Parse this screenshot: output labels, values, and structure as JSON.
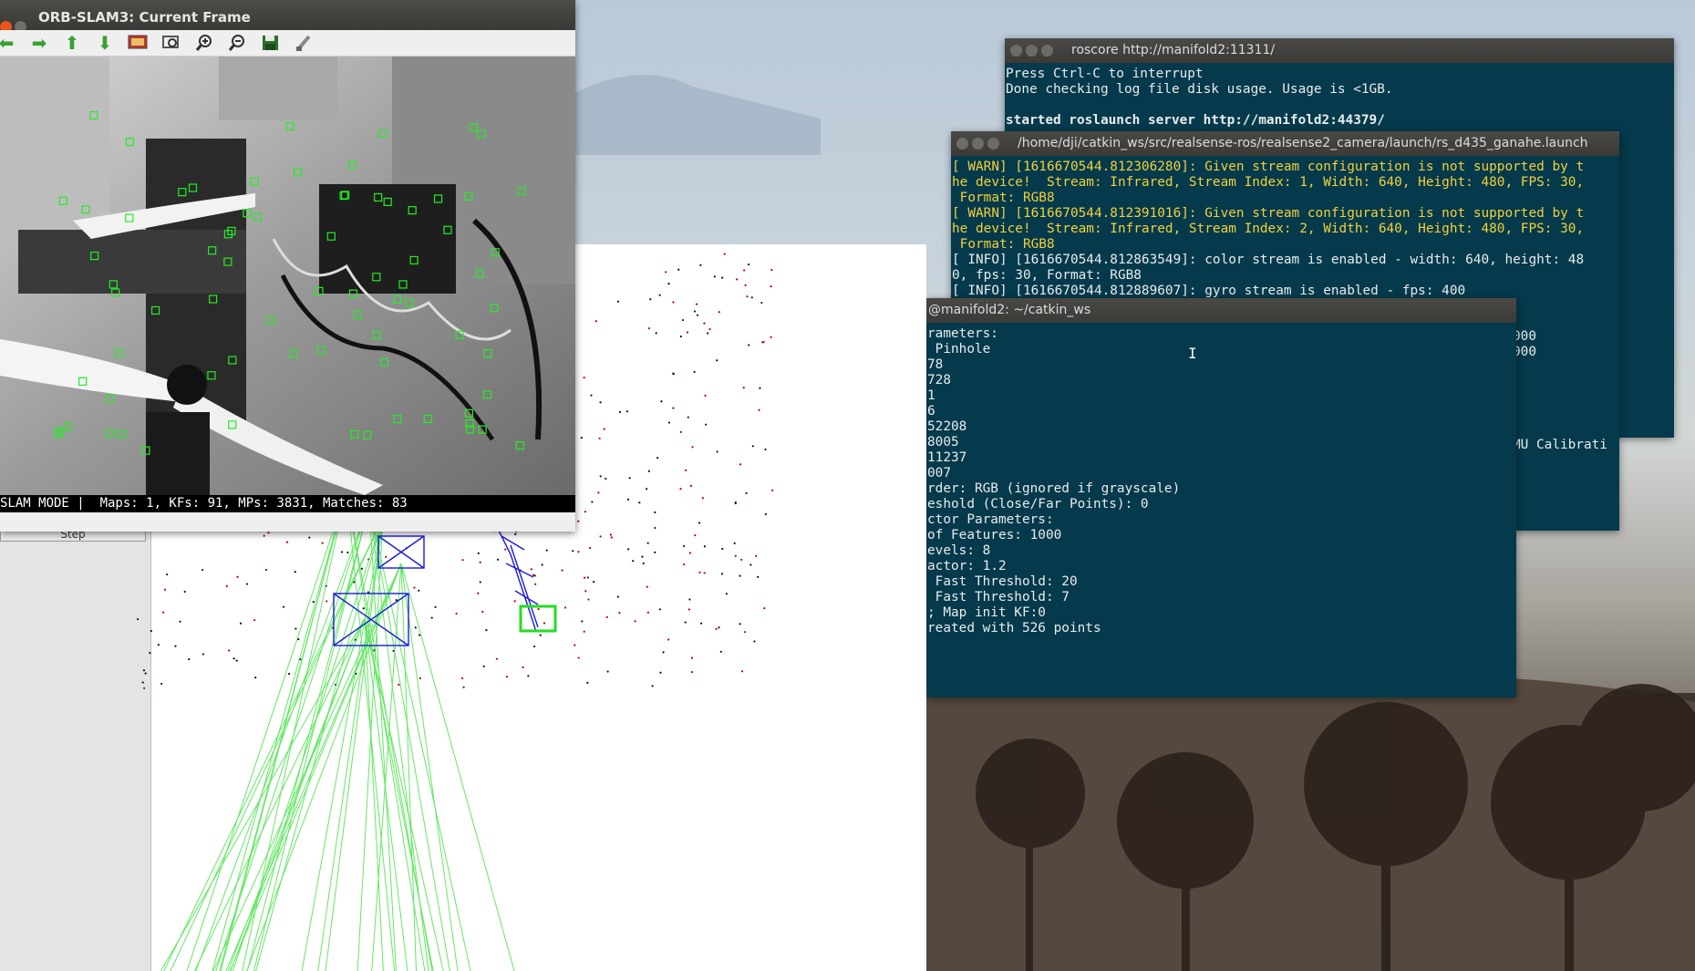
{
  "frame_window": {
    "title": "ORB-SLAM3: Current Frame",
    "status": "SLAM MODE |  Maps: 1, KFs: 91, MPs: 3831, Matches: 83",
    "toolbar": [
      "back-arrow-icon",
      "forward-arrow-icon",
      "up-arrow-icon",
      "down-arrow-icon",
      "image-icon",
      "zoom-fit-icon",
      "zoom-in-icon",
      "zoom-out-icon",
      "save-icon",
      "brush-icon"
    ]
  },
  "map_viewer": {
    "step_label": "Step"
  },
  "roscore_terminal": {
    "title": "roscore http://manifold2:11311/",
    "lines": [
      "Press Ctrl-C to interrupt",
      "Done checking log file disk usage. Usage is <1GB.",
      "",
      "started roslaunch server http://manifold2:44379/"
    ]
  },
  "realsense_terminal": {
    "title": "/home/dji/catkin_ws/src/realsense-ros/realsense2_camera/launch/rs_d435_ganahe.launch",
    "lines": [
      "[ WARN] [1616670544.812306280]: Given stream configuration is not supported by t",
      "he device!  Stream: Infrared, Stream Index: 1, Width: 640, Height: 480, FPS: 30,",
      " Format: RGB8",
      "[ WARN] [1616670544.812391016]: Given stream configuration is not supported by t",
      "he device!  Stream: Infrared, Stream Index: 2, Width: 640, Height: 480, FPS: 30,",
      " Format: RGB8",
      "[ INFO] [1616670544.812863549]: color stream is enabled - width: 640, height: 48",
      "0, fps: 30, Format: RGB8",
      "[ INFO] [1616670544.812889607]: gyro stream is enabled - fps: 400"
    ],
    "right_fragments": [
      "000",
      "000",
      "MU Calibrati"
    ]
  },
  "catkin_terminal": {
    "title": "@manifold2: ~/catkin_ws",
    "lines": [
      "rameters:",
      " Pinhole",
      "78",
      "728",
      "1",
      "6",
      "52208",
      "8005",
      "11237",
      "007",
      "",
      "rder: RGB (ignored if grayscale)",
      "",
      "eshold (Close/Far Points): 0",
      "",
      "ctor Parameters:",
      "of Features: 1000",
      "evels: 8",
      "actor: 1.2",
      " Fast Threshold: 20",
      " Fast Threshold: 7",
      "; Map init KF:0",
      "reated with 526 points"
    ]
  },
  "colors": {
    "terminal_bg": "#053a4c",
    "warn_text": "#f2d13a",
    "feature_green": "#22ee22",
    "keyframe_blue": "#1a1ae0",
    "map_point_red": "#b00000"
  }
}
